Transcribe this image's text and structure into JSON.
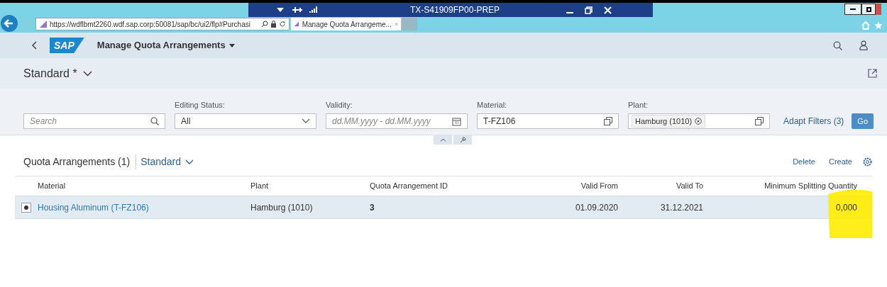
{
  "browser": {
    "session_title": "TX-S41909FP00-PREP",
    "url": "https://wdflbmt2260.wdf.sap.corp:50081/sap/bc/ui2/flp#Purchasi",
    "tab_title": "Manage Quota Arrangeme..."
  },
  "shell": {
    "logo": "SAP",
    "app_title": "Manage Quota Arrangements"
  },
  "variant": {
    "title": "Standard *"
  },
  "filters": {
    "search": {
      "placeholder": "Search"
    },
    "fields": [
      {
        "label": "Editing Status:",
        "kind": "select",
        "value": "All"
      },
      {
        "label": "Validity:",
        "kind": "date",
        "placeholder": "dd.MM.yyyy - dd.MM.yyyy"
      },
      {
        "label": "Material:",
        "kind": "valuehelp",
        "value": "T-FZ106"
      },
      {
        "label": "Plant:",
        "kind": "tokens",
        "tokens": [
          "Hamburg (1010)"
        ]
      }
    ],
    "adapt": "Adapt Filters (3)",
    "go": "Go"
  },
  "table": {
    "title": "Quota Arrangements (1)",
    "variant": "Standard",
    "actions": [
      "Delete",
      "Create"
    ],
    "columns": [
      {
        "label": "Material"
      },
      {
        "label": "Plant"
      },
      {
        "label": "Quota Arrangement ID"
      },
      {
        "label": "Valid From"
      },
      {
        "label": "Valid To"
      },
      {
        "label": "Minimum Splitting Quantity"
      }
    ],
    "rows": [
      {
        "selected": true,
        "cells": [
          {
            "text": "Housing Aluminum (T-FZ106)",
            "kind": "link"
          },
          {
            "text": "Hamburg (1010)",
            "kind": "text"
          },
          {
            "text": "3",
            "kind": "bold"
          },
          {
            "text": "01.09.2020",
            "kind": "text"
          },
          {
            "text": "31.12.2021",
            "kind": "text"
          },
          {
            "text": "0,000",
            "kind": "highlighted"
          }
        ]
      }
    ]
  }
}
